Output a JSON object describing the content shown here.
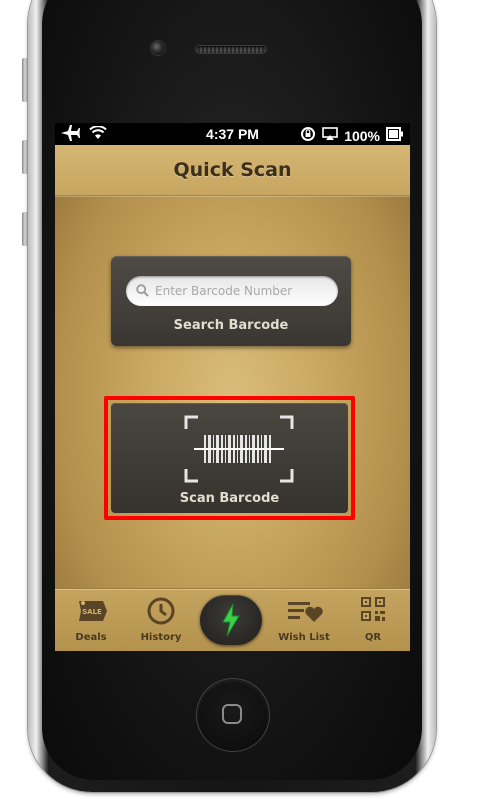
{
  "status_bar": {
    "time": "4:37 PM",
    "battery": "100%",
    "icons": [
      "airplane-icon",
      "wifi-icon",
      "rotation-lock-icon",
      "airplay-icon",
      "battery-icon"
    ]
  },
  "nav": {
    "title": "Quick Scan"
  },
  "search": {
    "placeholder": "Enter Barcode Number",
    "label": "Search Barcode"
  },
  "scan": {
    "label": "Scan Barcode"
  },
  "tabs": [
    {
      "label": "Deals",
      "icon": "sale-tag-icon"
    },
    {
      "label": "History",
      "icon": "clock-icon"
    },
    {
      "label": "",
      "icon": "lightning-icon"
    },
    {
      "label": "Wish List",
      "icon": "list-heart-icon"
    },
    {
      "label": "QR",
      "icon": "qr-code-icon"
    }
  ],
  "colors": {
    "background": "#c9a862",
    "card": "#3f3b35",
    "highlight": "#ff0000",
    "accent_green": "#3ad24a",
    "text_dark": "#3c2f1c"
  }
}
